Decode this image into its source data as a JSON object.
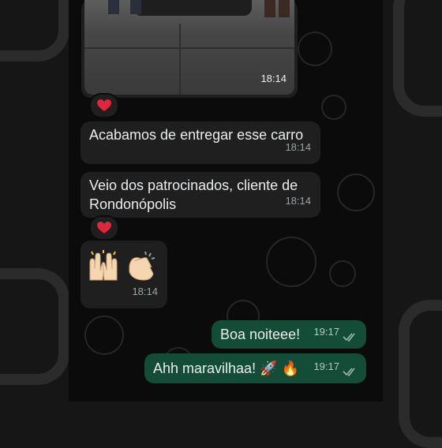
{
  "messages": {
    "photo": {
      "time": "18:14"
    },
    "m1": {
      "text": "Acabamos de entregar esse carro",
      "time": "18:14"
    },
    "m2": {
      "line1": "Veio dos patrocinados, cliente de",
      "line2": "Rondonópolis",
      "time": "18:14"
    },
    "m3": {
      "time": "18:14"
    },
    "out1": {
      "text": "Boa noiteee!",
      "time": "19:17"
    },
    "out2": {
      "text": "Ahh maravilhaa! 🚀 🔥",
      "time": "19:17"
    }
  },
  "reactions": {
    "r1": "heart",
    "r2": "heart"
  },
  "colors": {
    "incoming": "#1f1f1f",
    "outgoing": "#144d37",
    "ticks": "#9fb8ad"
  },
  "icons": [
    "heart-icon",
    "raising-hands-icon",
    "clapping-hands-icon",
    "double-check-icon"
  ]
}
